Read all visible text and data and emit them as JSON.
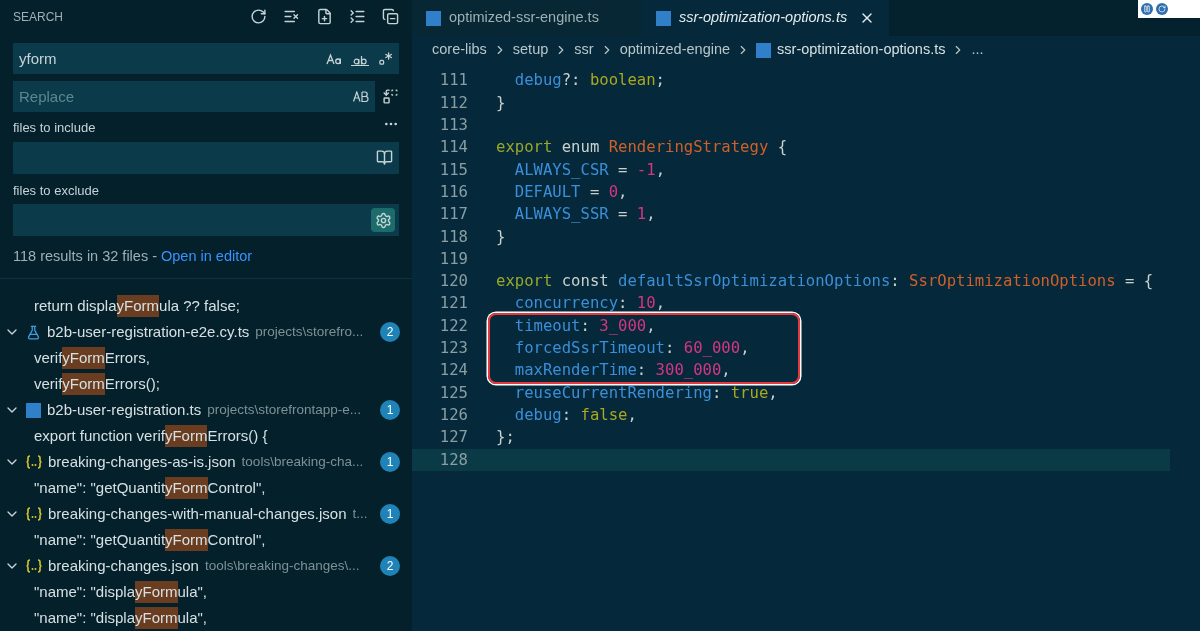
{
  "search": {
    "title": "SEARCH",
    "query": "yform",
    "replace_placeholder": "Replace",
    "include_label": "files to include",
    "exclude_label": "files to exclude",
    "summary": "118 results in 32 files - ",
    "open_link": "Open in editor",
    "results": [
      {
        "kind": "match",
        "before": "return displa",
        "match": "yForm",
        "after": "ula ?? false;"
      },
      {
        "kind": "test_file",
        "name": "b2b-user-registration-e2e.cy.ts",
        "path": "projects\\storefro...",
        "count": "2",
        "expanded": true
      },
      {
        "kind": "match",
        "before": "verif",
        "match": "yForm",
        "after": "Errors,"
      },
      {
        "kind": "match",
        "before": "verif",
        "match": "yForm",
        "after": "Errors();"
      },
      {
        "kind": "ts_file",
        "name": "b2b-user-registration.ts",
        "path": "projects\\storefrontapp-e...",
        "count": "1",
        "expanded": true
      },
      {
        "kind": "match",
        "before": "export function verif",
        "match": "yForm",
        "after": "Errors() {"
      },
      {
        "kind": "json_file",
        "name": "breaking-changes-as-is.json",
        "path": "tools\\breaking-cha...",
        "count": "1",
        "expanded": true
      },
      {
        "kind": "match",
        "before": "\"name\": \"getQuantit",
        "match": "yForm",
        "after": "Control\","
      },
      {
        "kind": "json_file",
        "name": "breaking-changes-with-manual-changes.json",
        "path": "t...",
        "count": "1",
        "expanded": true
      },
      {
        "kind": "match",
        "before": "\"name\": \"getQuantit",
        "match": "yForm",
        "after": "Control\","
      },
      {
        "kind": "json_file",
        "name": "breaking-changes.json",
        "path": "tools\\breaking-changes\\...",
        "count": "2",
        "expanded": true
      },
      {
        "kind": "match",
        "before": "\"name\": \"displa",
        "match": "yForm",
        "after": "ula\","
      },
      {
        "kind": "match",
        "before": "\"name\": \"displa",
        "match": "yForm",
        "after": "ula\","
      }
    ]
  },
  "tabs": [
    {
      "label": "optimized-ssr-engine.ts",
      "selected": false
    },
    {
      "label": "ssr-optimization-options.ts",
      "selected": true
    }
  ],
  "breadcrumbs": [
    {
      "label": "core-libs",
      "file": false
    },
    {
      "label": "setup",
      "file": false
    },
    {
      "label": "ssr",
      "file": false
    },
    {
      "label": "optimized-engine",
      "file": false
    },
    {
      "label": "ssr-optimization-options.ts",
      "file": true
    },
    {
      "label": "...",
      "file": false
    }
  ],
  "code": [
    {
      "n": "111",
      "boxed": false,
      "current": false,
      "tokens": [
        {
          "kind": "prop",
          "t": "  debug"
        },
        {
          "kind": "punct",
          "t": "?: "
        },
        {
          "kind": "bool",
          "t": "boolean"
        },
        {
          "kind": "punct",
          "t": ";"
        }
      ]
    },
    {
      "n": "112",
      "boxed": false,
      "current": false,
      "tokens": [
        {
          "kind": "punct",
          "t": "}"
        }
      ]
    },
    {
      "n": "113",
      "boxed": false,
      "current": false
    },
    {
      "n": "114",
      "boxed": false,
      "current": false,
      "tokens": [
        {
          "kind": "kw",
          "t": "export"
        },
        {
          "kind": "plain",
          "t": " enum "
        },
        {
          "kind": "type",
          "t": "RenderingStrategy"
        },
        {
          "kind": "punct",
          "t": " {"
        }
      ]
    },
    {
      "n": "115",
      "boxed": false,
      "current": false,
      "tokens": [
        {
          "kind": "prop",
          "t": "  ALWAYS_CSR"
        },
        {
          "kind": "punct",
          "t": " = "
        },
        {
          "kind": "num",
          "t": "-1"
        },
        {
          "kind": "punct",
          "t": ","
        }
      ]
    },
    {
      "n": "116",
      "boxed": false,
      "current": false,
      "tokens": [
        {
          "kind": "prop",
          "t": "  DEFAULT"
        },
        {
          "kind": "punct",
          "t": " = "
        },
        {
          "kind": "num",
          "t": "0"
        },
        {
          "kind": "punct",
          "t": ","
        }
      ]
    },
    {
      "n": "117",
      "boxed": false,
      "current": false,
      "tokens": [
        {
          "kind": "prop",
          "t": "  ALWAYS_SSR"
        },
        {
          "kind": "punct",
          "t": " = "
        },
        {
          "kind": "num",
          "t": "1"
        },
        {
          "kind": "punct",
          "t": ","
        }
      ]
    },
    {
      "n": "118",
      "boxed": false,
      "current": false,
      "tokens": [
        {
          "kind": "punct",
          "t": "}"
        }
      ]
    },
    {
      "n": "119",
      "boxed": false,
      "current": false
    },
    {
      "n": "120",
      "boxed": false,
      "current": false,
      "tokens": [
        {
          "kind": "kw",
          "t": "export"
        },
        {
          "kind": "plain",
          "t": " const "
        },
        {
          "kind": "prop",
          "t": "defaultSsrOptimizationOptions"
        },
        {
          "kind": "punct",
          "t": ": "
        },
        {
          "kind": "type",
          "t": "SsrOptimizationOptions"
        },
        {
          "kind": "punct",
          "t": " = {"
        }
      ]
    },
    {
      "n": "121",
      "boxed": false,
      "current": false,
      "tokens": [
        {
          "kind": "prop",
          "t": "  concurrency"
        },
        {
          "kind": "punct",
          "t": ": "
        },
        {
          "kind": "num",
          "t": "10"
        },
        {
          "kind": "punct",
          "t": ","
        }
      ]
    },
    {
      "n": "122",
      "boxed": true,
      "current": false,
      "tokens": [
        {
          "kind": "prop",
          "t": "  timeout"
        },
        {
          "kind": "punct",
          "t": ": "
        },
        {
          "kind": "num",
          "t": "3_000"
        },
        {
          "kind": "punct",
          "t": ","
        }
      ]
    },
    {
      "n": "123",
      "boxed": true,
      "current": false,
      "tokens": [
        {
          "kind": "prop",
          "t": "  forcedSsrTimeout"
        },
        {
          "kind": "punct",
          "t": ": "
        },
        {
          "kind": "num",
          "t": "60_000"
        },
        {
          "kind": "punct",
          "t": ","
        }
      ]
    },
    {
      "n": "124",
      "boxed": true,
      "current": false,
      "tokens": [
        {
          "kind": "prop",
          "t": "  maxRenderTime"
        },
        {
          "kind": "punct",
          "t": ": "
        },
        {
          "kind": "num",
          "t": "300_000"
        },
        {
          "kind": "punct",
          "t": ","
        }
      ]
    },
    {
      "n": "125",
      "boxed": false,
      "current": false,
      "tokens": [
        {
          "kind": "prop",
          "t": "  reuseCurrentRendering"
        },
        {
          "kind": "punct",
          "t": ": "
        },
        {
          "kind": "bool",
          "t": "true"
        },
        {
          "kind": "punct",
          "t": ","
        }
      ]
    },
    {
      "n": "126",
      "boxed": false,
      "current": false,
      "tokens": [
        {
          "kind": "prop",
          "t": "  debug"
        },
        {
          "kind": "punct",
          "t": ": "
        },
        {
          "kind": "bool",
          "t": "false"
        },
        {
          "kind": "punct",
          "t": ","
        }
      ]
    },
    {
      "n": "127",
      "boxed": false,
      "current": false,
      "tokens": [
        {
          "kind": "punct",
          "t": "};"
        }
      ]
    },
    {
      "n": "128",
      "boxed": false,
      "current": true
    }
  ]
}
